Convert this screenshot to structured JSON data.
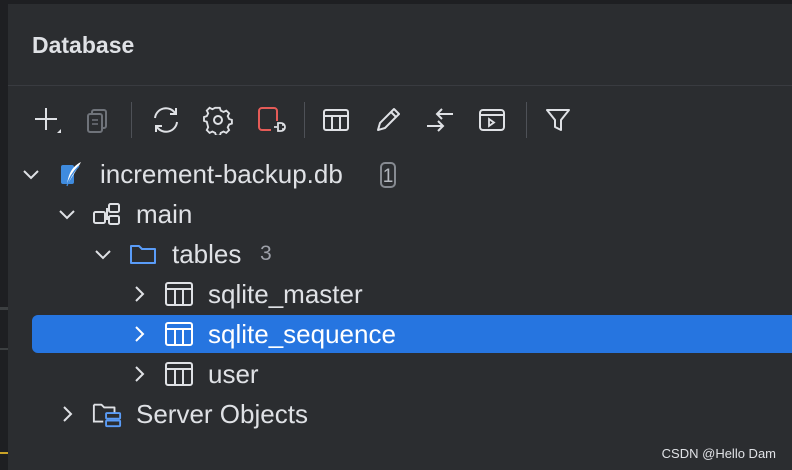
{
  "panel": {
    "title": "Database"
  },
  "toolbar": {
    "buttons": [
      {
        "name": "add-icon"
      },
      {
        "name": "duplicate-icon"
      },
      {
        "name": "refresh-icon"
      },
      {
        "name": "settings-icon"
      },
      {
        "name": "disconnect-icon"
      },
      {
        "name": "table-icon"
      },
      {
        "name": "edit-icon"
      },
      {
        "name": "jump-icon"
      },
      {
        "name": "console-icon"
      },
      {
        "name": "filter-icon"
      }
    ]
  },
  "tree": {
    "db": {
      "label": "increment-backup.db",
      "badge": "1"
    },
    "schema": {
      "label": "main"
    },
    "tables_folder": {
      "label": "tables",
      "count": "3"
    },
    "tables": [
      {
        "label": "sqlite_master",
        "selected": false
      },
      {
        "label": "sqlite_sequence",
        "selected": true
      },
      {
        "label": "user",
        "selected": false
      }
    ],
    "server_objects": {
      "label": "Server Objects"
    }
  },
  "watermark": "CSDN @Hello Dam",
  "colors": {
    "selection": "#2675e0",
    "background": "#2b2d30",
    "accent_red": "#e55b57",
    "folder_blue": "#5a9cf8"
  }
}
